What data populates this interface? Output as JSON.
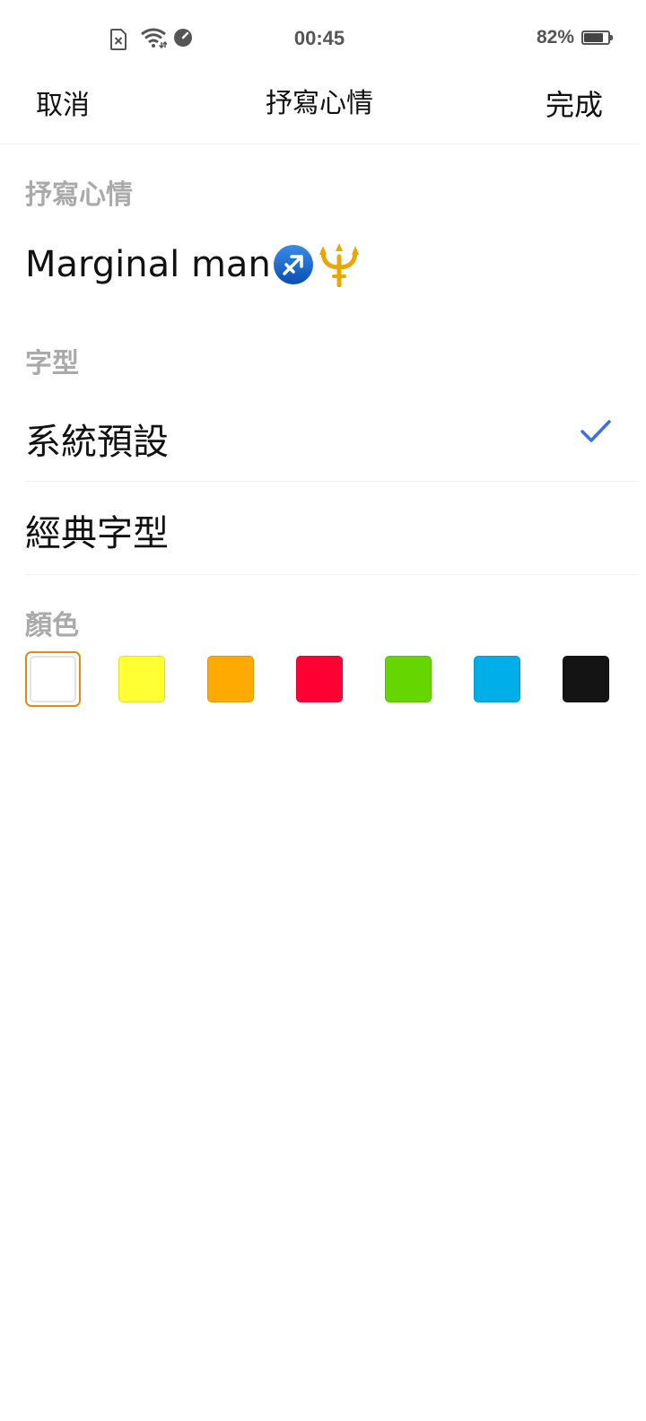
{
  "status_bar": {
    "time": "00:45",
    "battery_percent": "82%",
    "battery_level": 0.82,
    "icons": [
      "no-sim-icon",
      "wifi-icon",
      "data-saver-icon",
      "battery-icon"
    ]
  },
  "nav": {
    "cancel_label": "取消",
    "title": "抒寫心情",
    "done_label": "完成"
  },
  "mood": {
    "section_label": "抒寫心情",
    "text": "Marginal man",
    "emojis": [
      "sagittarius-emoji",
      "trident-emoji"
    ]
  },
  "font": {
    "section_label": "字型",
    "options": [
      {
        "label": "系統預設",
        "selected": true
      },
      {
        "label": "經典字型",
        "selected": false
      }
    ]
  },
  "color": {
    "section_label": "顏色",
    "swatches": [
      {
        "name": "white",
        "hex": "#ffffff",
        "selected": true
      },
      {
        "name": "yellow",
        "hex": "#ffff33",
        "selected": false
      },
      {
        "name": "orange",
        "hex": "#ffaa00",
        "selected": false
      },
      {
        "name": "red",
        "hex": "#ff0033",
        "selected": false
      },
      {
        "name": "green",
        "hex": "#66d600",
        "selected": false
      },
      {
        "name": "blue",
        "hex": "#00aee8",
        "selected": false
      },
      {
        "name": "black",
        "hex": "#141414",
        "selected": false
      }
    ],
    "selected_ring_color": "#e08a1e",
    "check_color": "#3d6fe0"
  }
}
